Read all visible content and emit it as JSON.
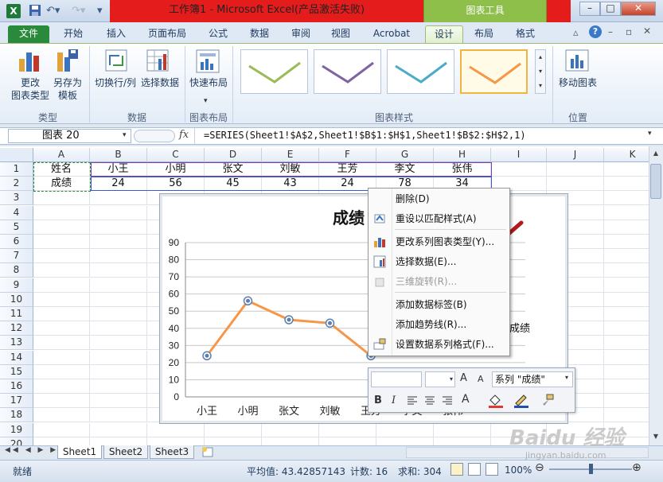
{
  "title": {
    "text": "工作簿1 - Microsoft Excel(产品激活失败)",
    "contextual_tab_group": "图表工具"
  },
  "window_buttons": [
    "–",
    "□",
    "✕"
  ],
  "ribbon_tabs": [
    "文件",
    "开始",
    "插入",
    "页面布局",
    "公式",
    "数据",
    "审阅",
    "视图",
    "Acrobat",
    "设计",
    "布局",
    "格式"
  ],
  "ribbon": {
    "groups": {
      "type": {
        "label": "类型",
        "buttons": [
          "更改\n图表类型",
          "另存为\n模板"
        ]
      },
      "data": {
        "label": "数据",
        "buttons": [
          "切换行/列",
          "选择数据"
        ]
      },
      "layout": {
        "label": "图表布局",
        "buttons": [
          "快速布局"
        ]
      },
      "styles": {
        "label": "图表样式"
      },
      "location": {
        "label": "位置",
        "buttons": [
          "移动图表"
        ]
      }
    },
    "btn_change_type": "更改",
    "btn_change_type2": "图表类型",
    "btn_save_as": "另存为",
    "btn_save_as2": "模板",
    "btn_switch": "切换行/列",
    "btn_select": "选择数据",
    "btn_quick": "快速布局",
    "btn_move": "移动图表",
    "style_colors": [
      "#9bbb59",
      "#8064a2",
      "#4bacc6",
      "#f79646"
    ]
  },
  "formula_bar": {
    "name_box": "图表 20",
    "fx": "fx",
    "formula": "=SERIES(Sheet1!$A$2,Sheet1!$B$1:$H$1,Sheet1!$B$2:$H$2,1)"
  },
  "columns": [
    "A",
    "B",
    "C",
    "D",
    "E",
    "F",
    "G",
    "H",
    "I",
    "J",
    "K"
  ],
  "rows": [
    "1",
    "2",
    "3",
    "4",
    "5",
    "6",
    "7",
    "8",
    "9",
    "10",
    "11",
    "12",
    "13",
    "14",
    "15",
    "16",
    "17",
    "18",
    "19",
    "20"
  ],
  "cells": {
    "row1": [
      "姓名",
      "小王",
      "小明",
      "张文",
      "刘敏",
      "王芳",
      "李文",
      "张伟"
    ],
    "row2": [
      "成绩",
      "24",
      "56",
      "45",
      "43",
      "24",
      "78",
      "34"
    ]
  },
  "chart": {
    "title": "成绩",
    "legend": "成绩",
    "y_ticks": [
      "90",
      "80",
      "70",
      "60",
      "50",
      "40",
      "30",
      "20",
      "10",
      "0"
    ],
    "x_ticks": [
      "小王",
      "小明",
      "张文",
      "刘敏",
      "王芳",
      "李文",
      "张伟"
    ]
  },
  "chart_data": {
    "type": "line",
    "title": "成绩",
    "categories": [
      "小王",
      "小明",
      "张文",
      "刘敏",
      "王芳",
      "李文",
      "张伟"
    ],
    "series": [
      {
        "name": "成绩",
        "values": [
          24,
          56,
          45,
          43,
          24,
          78,
          34
        ],
        "color": "#f79646"
      }
    ],
    "ylim": [
      0,
      90
    ],
    "grid": true,
    "legend": "right"
  },
  "context_menu": {
    "items": [
      {
        "label": "删除(D)",
        "disabled": false,
        "icon": "none"
      },
      {
        "label": "重设以匹配样式(A)",
        "disabled": false,
        "icon": "reset-style-icon"
      },
      {
        "label": "更改系列图表类型(Y)...",
        "disabled": false,
        "icon": "chart-type-icon"
      },
      {
        "label": "选择数据(E)...",
        "disabled": false,
        "icon": "select-data-icon"
      },
      {
        "label": "三维旋转(R)...",
        "disabled": true,
        "icon": "rotate-3d-icon"
      },
      {
        "label": "添加数据标签(B)",
        "disabled": false,
        "icon": "none"
      },
      {
        "label": "添加趋势线(R)...",
        "disabled": false,
        "icon": "none"
      },
      {
        "label": "设置数据系列格式(F)...",
        "disabled": false,
        "icon": "format-series-icon"
      }
    ]
  },
  "mini_toolbar": {
    "series_select": "系列 \"成绩\"",
    "bold": "B",
    "italic": "I",
    "grow_font": "A",
    "shrink_font": "A",
    "font_color": "A"
  },
  "sheets": [
    "Sheet1",
    "Sheet2",
    "Sheet3"
  ],
  "status": {
    "mode": "就绪",
    "average": "平均值: 43.42857143",
    "count": "计数: 16",
    "sum": "求和: 304",
    "zoom": "100%"
  },
  "watermark": {
    "text": "Baidu 经验",
    "sub": "jingyan.baidu.com"
  }
}
